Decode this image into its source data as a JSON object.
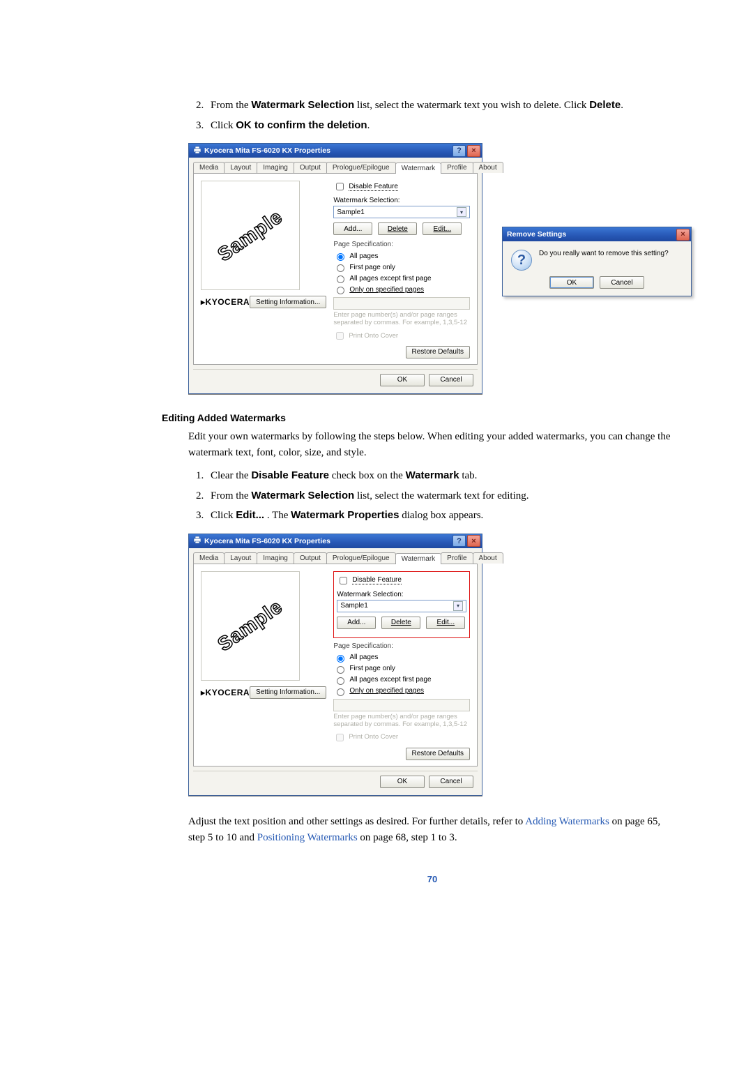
{
  "steps_top": [
    {
      "prefix": "From the ",
      "b1": "Watermark Selection",
      "mid": " list, select the watermark text you wish to delete. Click ",
      "b2": "Delete",
      "suffix": "."
    },
    {
      "prefix": "Click ",
      "b1": "OK to confirm the deletion",
      "mid": "",
      "b2": "",
      "suffix": "."
    }
  ],
  "dlg": {
    "title": "Kyocera Mita FS-6020 KX Properties",
    "tabs": [
      "Media",
      "Layout",
      "Imaging",
      "Output",
      "Prologue/Epilogue",
      "Watermark",
      "Profile",
      "About"
    ],
    "activeTab": "Watermark",
    "preview": "Sample",
    "disable_feature": "Disable Feature",
    "wmsel": "Watermark Selection:",
    "selected": "Sample1",
    "btn_add": "Add...",
    "btn_del": "Delete",
    "btn_edit": "Edit...",
    "pagespec": "Page Specification:",
    "radios": [
      "All pages",
      "First page only",
      "All pages except first page",
      "Only on specified pages"
    ],
    "help": "Enter page number(s) and/or page ranges separated by commas. For example, 1,3,5-12",
    "print_data": "Print Onto Cover",
    "brand": "KYOCERA",
    "setting_info": "Setting Information...",
    "restore": "Restore Defaults",
    "ok": "OK",
    "cancel": "Cancel"
  },
  "confirm": {
    "title": "Remove Settings",
    "msg": "Do you really want to remove this setting?",
    "ok": "OK",
    "cancel": "Cancel"
  },
  "section": {
    "heading": "Editing Added Watermarks",
    "body": "Edit your own watermarks by following the steps below. When editing your added watermarks, you can change the watermark text, font, color, size, and style."
  },
  "steps_mid": [
    {
      "prefix": "Clear the ",
      "b1": "Disable Feature",
      "mid": " check box on the ",
      "b2": "Watermark",
      "suffix": " tab."
    },
    {
      "prefix": "From the ",
      "b1": "Watermark Selection",
      "mid": " list, select the watermark text for editing.",
      "b2": "",
      "suffix": ""
    },
    {
      "prefix": "Click ",
      "b1": "Edit...",
      "mid": " . The ",
      "b2": "Watermark Properties",
      "suffix": " dialog box appears."
    }
  ],
  "bottom_para": {
    "t1": "Adjust the text position and other settings as desired. For further details, refer to ",
    "l1": "Adding Watermarks",
    "t2": " on page 65, step 5 to 10 and ",
    "l2": "Positioning Watermarks",
    "t3": " on page 68, step 1 to 3."
  },
  "page_num": "70"
}
